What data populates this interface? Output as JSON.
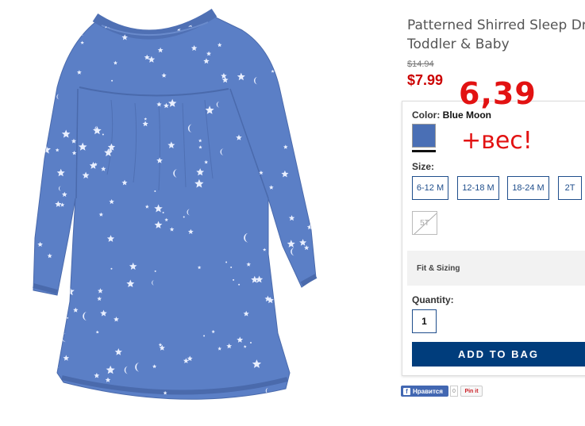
{
  "product": {
    "title": "Patterned Shirred Sleep Dr",
    "subtitle": "Toddler & Baby",
    "old_price": "$14.94",
    "price": "$7.99"
  },
  "annotations": {
    "price_note": "6,39",
    "weight_note": "+вес!",
    "color": "#e21212"
  },
  "color": {
    "label": "Color:",
    "selected": "Blue Moon",
    "swatch_color": "#4a6fb5"
  },
  "size": {
    "label": "Size:",
    "options": [
      "6-12 M",
      "12-18 M",
      "18-24 M",
      "2T"
    ],
    "unavailable": "5T"
  },
  "fit": {
    "label": "Fit & Sizing"
  },
  "quantity": {
    "label": "Quantity:",
    "value": "1"
  },
  "cart": {
    "add_label": "ADD TO BAG",
    "button_color": "#003d7c"
  },
  "social": {
    "fb_icon": "f",
    "fb_like": "Нравится",
    "fb_count": "0",
    "pin_label": "Pin it"
  }
}
